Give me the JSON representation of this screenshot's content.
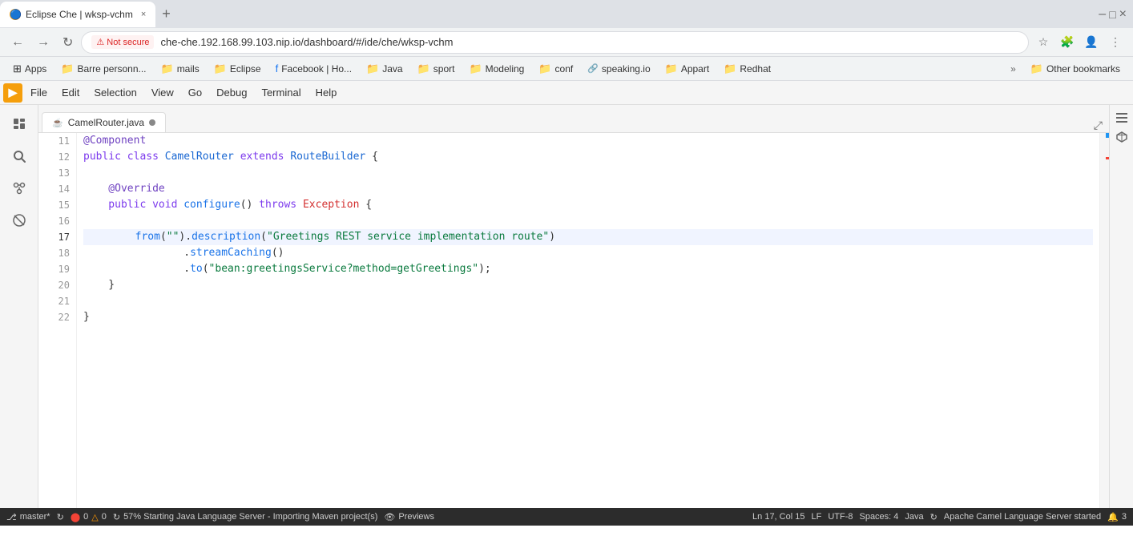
{
  "browser": {
    "tab_favicon": "🌐",
    "tab_title": "Eclipse Che | wksp-vchm",
    "tab_close": "×",
    "new_tab": "+",
    "nav_back": "←",
    "nav_forward": "→",
    "nav_refresh": "↻",
    "security_warning": "⚠",
    "security_label": "Not secure",
    "address": "che-che.192.168.99.103.nip.io/dashboard/#/ide/che/wksp-vchm",
    "star_icon": "☆",
    "extensions_icon": "🧩"
  },
  "bookmarks": {
    "apps_label": "Apps",
    "items": [
      {
        "label": "Barre personn...",
        "type": "folder"
      },
      {
        "label": "mails",
        "type": "folder"
      },
      {
        "label": "Eclipse",
        "type": "folder"
      },
      {
        "label": "Facebook | Ho...",
        "type": "facebook"
      },
      {
        "label": "Java",
        "type": "folder"
      },
      {
        "label": "sport",
        "type": "folder"
      },
      {
        "label": "Modeling",
        "type": "folder"
      },
      {
        "label": "conf",
        "type": "folder"
      },
      {
        "label": "speaking.io",
        "type": "link"
      },
      {
        "label": "Appart",
        "type": "folder"
      },
      {
        "label": "Redhat",
        "type": "folder"
      }
    ],
    "more": "»",
    "other_bookmarks": "Other bookmarks"
  },
  "ide": {
    "menu_indicator": "▶",
    "menu_items": [
      "File",
      "Edit",
      "Selection",
      "View",
      "Go",
      "Debug",
      "Terminal",
      "Help"
    ],
    "tab_filename": "CamelRouter.java",
    "tab_dirty": true,
    "sidebar_icons": [
      "📄",
      "🔍",
      "⎇",
      "🌐"
    ],
    "right_icons": [
      "☰",
      "📦"
    ]
  },
  "code": {
    "lines": [
      {
        "num": 11,
        "content": "@Component",
        "type": "annotation"
      },
      {
        "num": 12,
        "content": "public class CamelRouter extends RouteBuilder {",
        "type": "class_decl"
      },
      {
        "num": 13,
        "content": "",
        "type": "empty"
      },
      {
        "num": 14,
        "content": "    @Override",
        "type": "annotation"
      },
      {
        "num": 15,
        "content": "    public void configure() throws Exception {",
        "type": "method_decl"
      },
      {
        "num": 16,
        "content": "",
        "type": "empty"
      },
      {
        "num": 17,
        "content": "        from(\"\").description(\"Greetings REST service implementation route\")",
        "type": "code_active"
      },
      {
        "num": 18,
        "content": "                .streamCaching()",
        "type": "code"
      },
      {
        "num": 19,
        "content": "                .to(\"bean:greetingsService?method=getGreetings\");",
        "type": "code"
      },
      {
        "num": 20,
        "content": "    }",
        "type": "code"
      },
      {
        "num": 21,
        "content": "",
        "type": "empty"
      },
      {
        "num": 22,
        "content": "}",
        "type": "code"
      }
    ]
  },
  "status_bar": {
    "branch": "master*",
    "sync_icon": "↻",
    "errors": "0",
    "error_icon": "⬤",
    "warnings": "0",
    "warning_icon": "△",
    "progress_icon": "↻",
    "progress_text": "57% Starting Java Language Server - Importing Maven project(s)",
    "preview_icon": "👁",
    "preview_text": "Previews",
    "line_col": "Ln 17, Col 15",
    "encoding": "LF",
    "charset": "UTF-8",
    "spaces": "Spaces: 4",
    "language": "Java",
    "server_sync": "↻",
    "server_status": "Apache Camel Language Server started",
    "notification_count": "3",
    "notification_icon": "🔔"
  }
}
